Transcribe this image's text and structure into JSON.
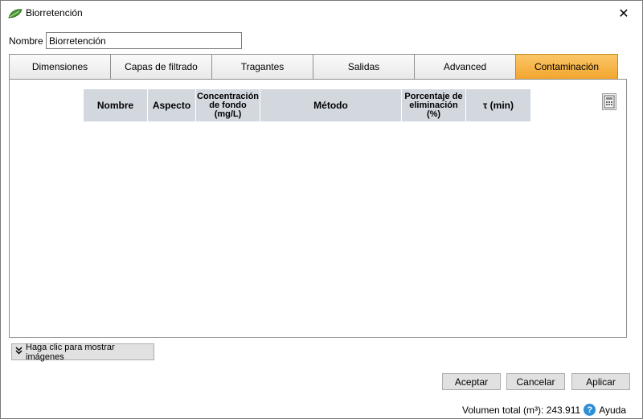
{
  "window": {
    "title": "Biorretención",
    "close_glyph": "✕"
  },
  "form": {
    "name_label": "Nombre",
    "name_value": "Biorretención"
  },
  "tabs": [
    {
      "label": "Dimensiones",
      "active": false
    },
    {
      "label": "Capas de filtrado",
      "active": false
    },
    {
      "label": "Tragantes",
      "active": false
    },
    {
      "label": "Salidas",
      "active": false
    },
    {
      "label": "Advanced",
      "active": false
    },
    {
      "label": "Contaminación",
      "active": true
    }
  ],
  "grid": {
    "columns": [
      {
        "label": "Nombre"
      },
      {
        "label": "Aspecto"
      },
      {
        "label": "Concentración de fondo (mg/L)"
      },
      {
        "label": "Método"
      },
      {
        "label": "Porcentaje de eliminación (%)"
      },
      {
        "label": "τ (min)"
      }
    ],
    "rows": []
  },
  "icons": {
    "app": "leaf-icon",
    "calculator": "calculator-icon",
    "expand": "double-chevron-down-icon",
    "help": "help-icon"
  },
  "show_images_label": "Haga clic para mostrar imágenes",
  "buttons": {
    "accept": "Aceptar",
    "cancel": "Cancelar",
    "apply": "Aplicar"
  },
  "status": {
    "volume_text": "Volumen total (m³): 243.911",
    "help_glyph": "?",
    "help_label": "Ayuda"
  },
  "colors": {
    "active_tab": "#f2a52e",
    "grid_header": "#d3d8df"
  }
}
